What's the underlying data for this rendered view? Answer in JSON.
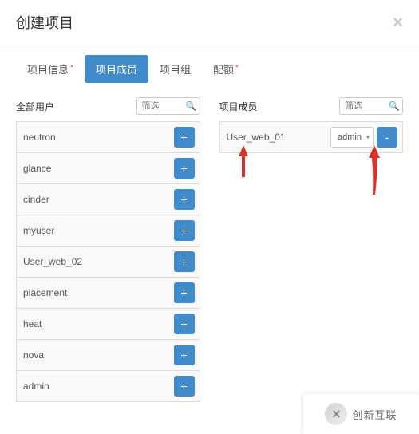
{
  "header": {
    "title": "创建项目"
  },
  "tabs": [
    {
      "label": "项目信息",
      "required": true,
      "active": false
    },
    {
      "label": "项目成员",
      "required": false,
      "active": true
    },
    {
      "label": "项目组",
      "required": false,
      "active": false
    },
    {
      "label": "配额",
      "required": true,
      "active": false
    }
  ],
  "required_mark": "*",
  "left": {
    "title": "全部用户",
    "filter_placeholder": "筛选",
    "items": [
      {
        "name": "neutron"
      },
      {
        "name": "glance"
      },
      {
        "name": "cinder"
      },
      {
        "name": "myuser"
      },
      {
        "name": "User_web_02"
      },
      {
        "name": "placement"
      },
      {
        "name": "heat"
      },
      {
        "name": "nova"
      },
      {
        "name": "admin"
      }
    ],
    "add_label": "+"
  },
  "right": {
    "title": "项目成员",
    "filter_placeholder": "筛选",
    "items": [
      {
        "name": "User_web_01",
        "role": "admin"
      }
    ],
    "remove_label": "-"
  },
  "icons": {
    "search": "🔍",
    "caret": "▾"
  },
  "logo": {
    "text": "创新互联"
  }
}
